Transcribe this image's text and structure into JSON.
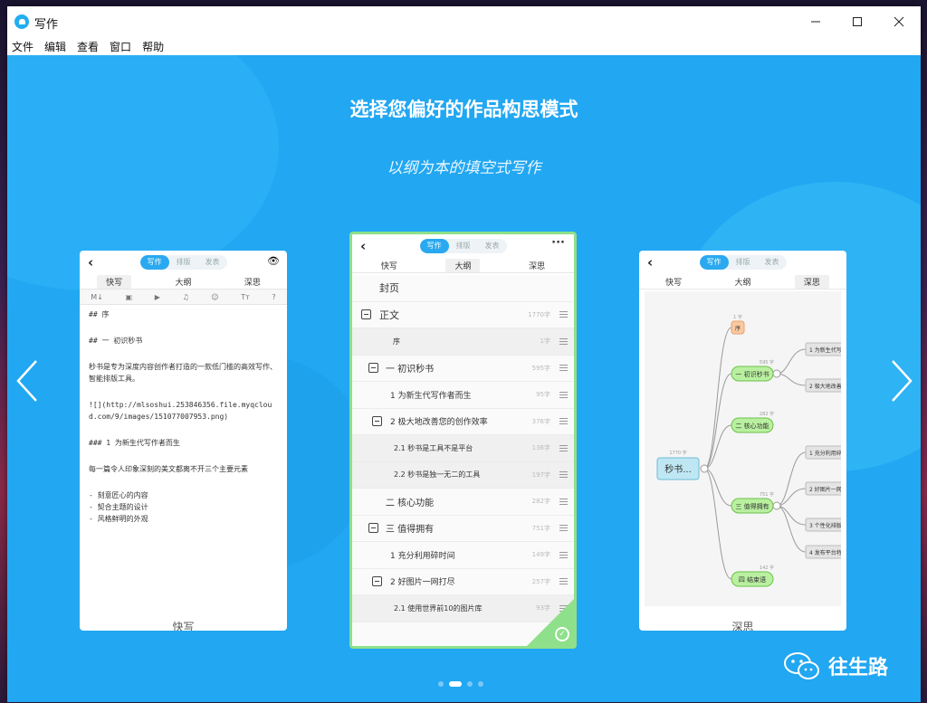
{
  "window": {
    "title": "写作",
    "controls": {
      "minimize": "—",
      "maximize": "☐",
      "close": "✕"
    }
  },
  "menu": [
    "文件",
    "编辑",
    "查看",
    "窗口",
    "帮助"
  ],
  "hero": {
    "headline": "选择您偏好的作品构思模式",
    "subline": "以纲为本的填空式写作"
  },
  "segments": [
    "写作",
    "排版",
    "发表"
  ],
  "tabs": [
    "快写",
    "大纲",
    "深思"
  ],
  "left_card": {
    "toolbar": [
      "M↓",
      "▣",
      "▶",
      "♫",
      "☺",
      "Tт",
      "?"
    ],
    "lines": [
      "## 序",
      "",
      "## 一 初识秒书",
      "",
      "秒书是专为深度内容创作者打造的一款低门槛的高效写作、智能排版工具。",
      "",
      "![](http://mlsoshui.253846356.file.myqcloud.com/9/images/151077007953.png)",
      "",
      "### 1 为新生代写作者而生",
      "",
      "每一篇令人印象深刻的美文都离不开三个主要元素",
      "",
      "- 刻意匠心的内容",
      "- 契合主题的设计",
      "- 风格鲜明的外观"
    ],
    "caption": "快写"
  },
  "mid_card": {
    "rows": [
      {
        "label": "封页",
        "count": ""
      },
      {
        "label": "正文",
        "count": "1770字"
      },
      {
        "label": "序",
        "count": "1字"
      },
      {
        "label": "一 初识秒书",
        "count": "595字"
      },
      {
        "label": "1 为新生代写作者而生",
        "count": "95字"
      },
      {
        "label": "2 极大地改善您的创作效率",
        "count": "376字"
      },
      {
        "label": "2.1 秒书是工具不是平台",
        "count": "136字"
      },
      {
        "label": "2.2 秒书是独一无二的工具",
        "count": "197字"
      },
      {
        "label": "二 核心功能",
        "count": "282字"
      },
      {
        "label": "三 值得拥有",
        "count": "751字"
      },
      {
        "label": "1 充分利用碎时间",
        "count": "149字"
      },
      {
        "label": "2 好图片一网打尽",
        "count": "257字"
      },
      {
        "label": "2.1 使用世界前10的图片库",
        "count": "93字"
      }
    ]
  },
  "right_card": {
    "root": "秒书...",
    "root_count": "1770 字",
    "branches": [
      {
        "label": "序",
        "count": "1 字"
      },
      {
        "label": "一 初识秒书",
        "count": "595 字"
      },
      {
        "label": "二 核心功能",
        "count": "282 字"
      },
      {
        "label": "三 值得拥有",
        "count": "751 字"
      },
      {
        "label": "四 结束语",
        "count": "142 字"
      }
    ],
    "leaves": [
      "1 为新生代写",
      "2 极大地改善",
      "1 充分利用碎",
      "2 好图片一网",
      "3 个性化排版",
      "4 发布平台特"
    ],
    "caption": "深思"
  },
  "watermark": "往生路",
  "pager": {
    "total": 4,
    "active": 1
  }
}
